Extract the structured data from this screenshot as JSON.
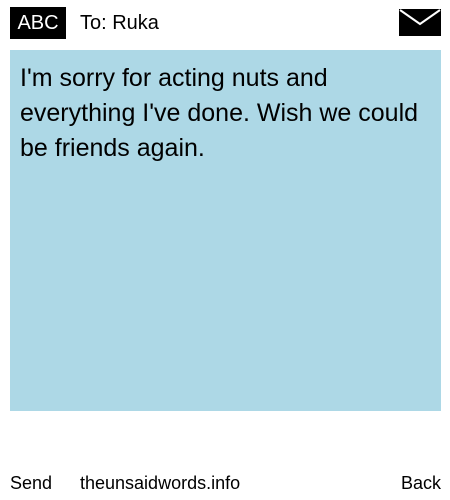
{
  "header": {
    "mode_label": "ABC",
    "recipient": "To: Ruka",
    "envelope_icon": "envelope-icon"
  },
  "message": {
    "text": "I'm sorry for acting nuts and everything I've done. Wish we could be friends again.",
    "background_color": "#add8e6"
  },
  "footer": {
    "send_label": "Send",
    "site_label": "theunsaidwords.info",
    "back_label": "Back"
  }
}
